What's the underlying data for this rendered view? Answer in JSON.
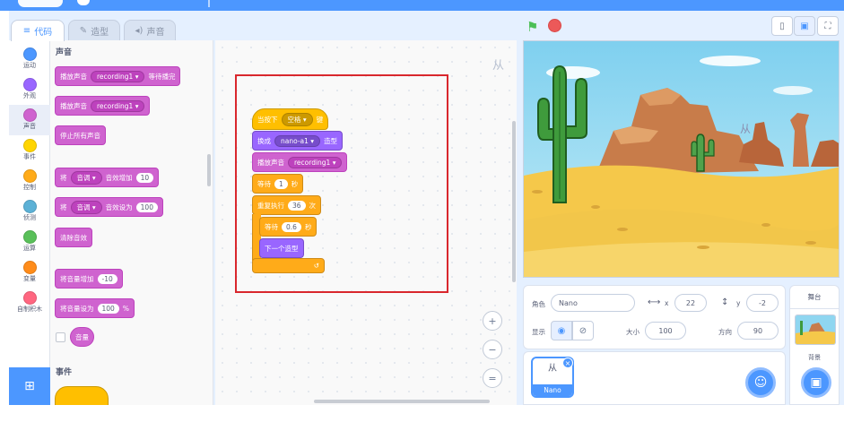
{
  "tabs": {
    "code": "代码",
    "costumes": "造型",
    "sounds": "声音"
  },
  "categories": [
    {
      "label": "运动",
      "color": "#4c97ff"
    },
    {
      "label": "外观",
      "color": "#9966ff"
    },
    {
      "label": "声音",
      "color": "#cf63cf"
    },
    {
      "label": "事件",
      "color": "#ffd500"
    },
    {
      "label": "控制",
      "color": "#ffab19"
    },
    {
      "label": "侦测",
      "color": "#5cb1d6"
    },
    {
      "label": "运算",
      "color": "#59c059"
    },
    {
      "label": "变量",
      "color": "#ff8c1a"
    },
    {
      "label": "自制积木",
      "color": "#ff6680"
    }
  ],
  "palette": {
    "sound_heading": "声音",
    "events_heading": "事件",
    "play_until_done": {
      "prefix": "播放声音",
      "sound": "recording1",
      "suffix": "等待播完"
    },
    "start_sound": {
      "prefix": "播放声音",
      "sound": "recording1"
    },
    "stop_all_sounds": "停止所有声音",
    "change_effect": {
      "prefix": "将",
      "effect": "音调",
      "middle": "音效增加",
      "value": "10"
    },
    "set_effect": {
      "prefix": "将",
      "effect": "音调",
      "middle": "音效设为",
      "value": "100"
    },
    "clear_effects": "清除音效",
    "change_volume": {
      "prefix": "将音量增加",
      "value": "-10"
    },
    "set_volume": {
      "prefix": "将音量设为",
      "value": "100",
      "suffix": "%"
    },
    "volume_reporter": "音量"
  },
  "script": {
    "when_key": {
      "prefix": "当按下",
      "key": "空格",
      "suffix": "键"
    },
    "switch_costume": {
      "prefix": "换成",
      "costume": "nano-a1",
      "suffix": "造型"
    },
    "start_sound": {
      "prefix": "播放声音",
      "sound": "recording1"
    },
    "wait1": {
      "prefix": "等待",
      "value": "1",
      "suffix": "秒"
    },
    "repeat": {
      "prefix": "重复执行",
      "value": "36",
      "suffix": "次"
    },
    "wait2": {
      "prefix": "等待",
      "value": "0.6",
      "suffix": "秒"
    },
    "next_costume": "下一个造型",
    "repeat_arrow": "↺",
    "watermark": "从"
  },
  "zoom": {
    "in": "+",
    "out": "−",
    "reset": "="
  },
  "sprite_info": {
    "sprite_label": "角色",
    "sprite_name": "Nano",
    "x_label": "x",
    "x_value": "22",
    "y_label": "y",
    "y_value": "-2",
    "show_label": "显示",
    "size_label": "大小",
    "size_value": "100",
    "direction_label": "方向",
    "direction_value": "90"
  },
  "sprite_list": [
    {
      "name": "Nano",
      "glyph": "从"
    }
  ],
  "stage_panel": {
    "heading": "舞台",
    "backdrops_label": "背景"
  },
  "colors": {
    "accent": "#4c97ff",
    "sound": "#cf63cf",
    "looks": "#9966ff",
    "events": "#ffbf00",
    "control": "#ffab19",
    "highlight_box": "#d9272d"
  }
}
